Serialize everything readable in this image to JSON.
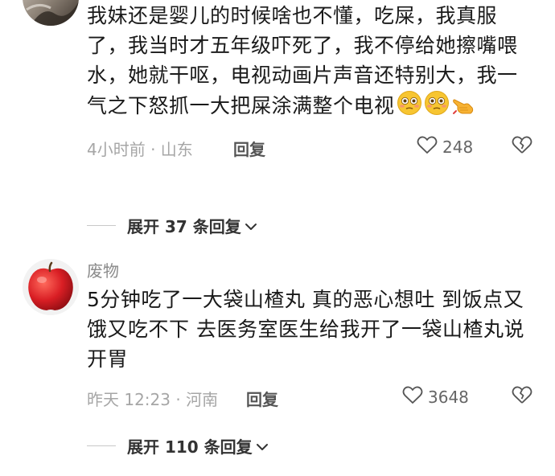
{
  "comments": [
    {
      "username": "",
      "text": "我妹还是婴儿的时候啥也不懂，吃屎，我真服了，我当时才五年级吓死了，我不停给她擦嘴喂水，她就干呕，电视动画片声音还特别大，我一气之下怒抓一大把屎涂满整个电视",
      "emojis": [
        "flushed-face-icon",
        "flushed-face-icon",
        "pointing-hand-icon"
      ],
      "time_location": "4小时前 · 山东",
      "reply_label": "回复",
      "likes": "248",
      "expand_label": "展开 37 条回复"
    },
    {
      "username": "废物",
      "text": "5分钟吃了一大袋山楂丸 真的恶心想吐 到饭点又饿又吃不下 去医务室医生给我开了一袋山楂丸说开胃",
      "time_location": "昨天 12:23 · 河南",
      "reply_label": "回复",
      "likes": "3648",
      "expand_label": "展开 110 条回复"
    }
  ],
  "colors": {
    "text": "#1a1a1a",
    "meta": "#a6a6a6",
    "emoji_yellow": "#f7c531",
    "apple_red": "#d91e24"
  }
}
